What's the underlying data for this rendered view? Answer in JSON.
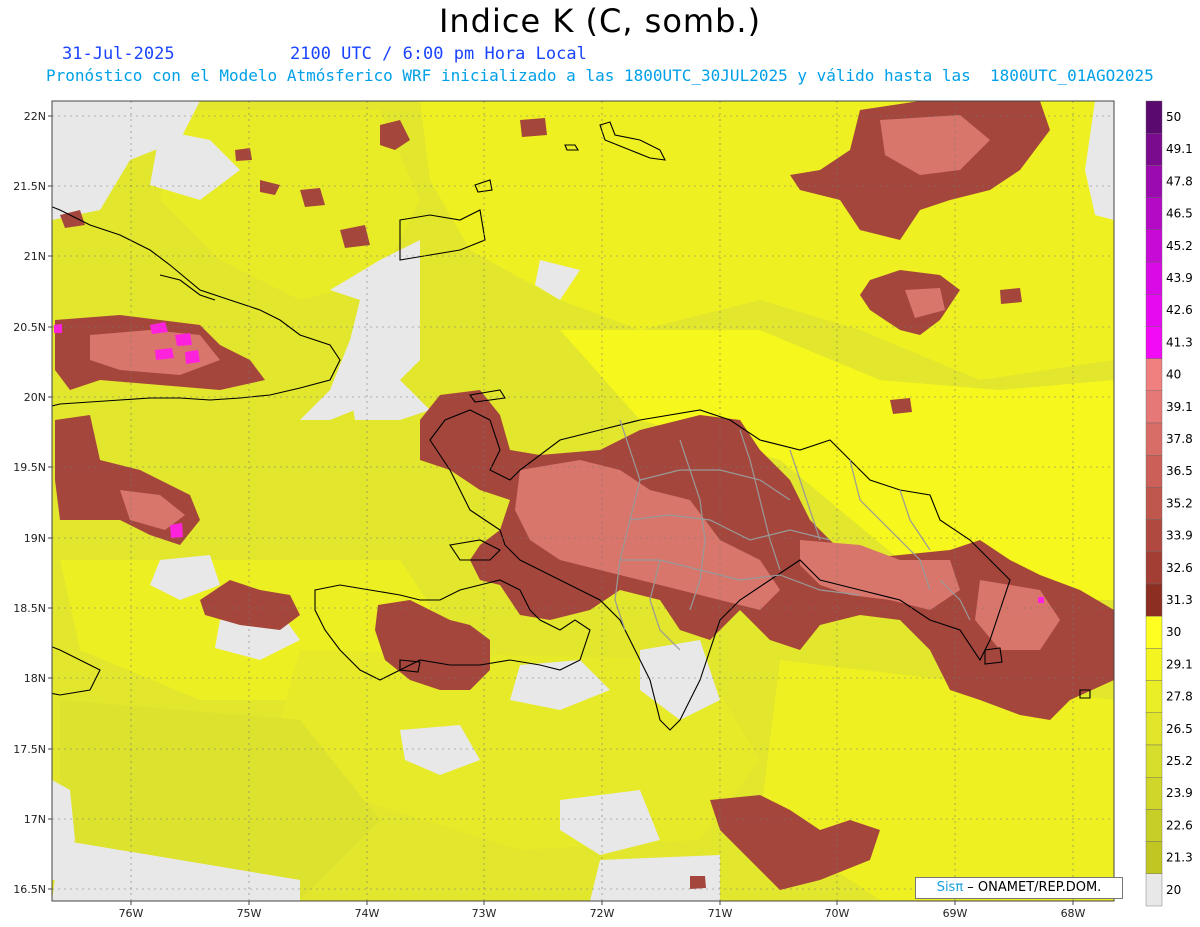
{
  "title": "Indice K (C, somb.)",
  "subtitle": {
    "date": "31-Jul-2025",
    "time": "2100 UTC / 6:00 pm Hora Local",
    "model_line": "Pronóstico con el Modelo Atmósferico WRF inicializado a las 1800UTC_30JUL2025 y válido hasta las  1800UTC_01AGO2025"
  },
  "axes": {
    "lat_labels": [
      "22N",
      "21.5N",
      "21N",
      "20.5N",
      "20N",
      "19.5N",
      "19N",
      "18.5N",
      "18N",
      "17.5N",
      "17N",
      "16.5N"
    ],
    "lon_labels": [
      "76W",
      "75W",
      "74W",
      "73W",
      "72W",
      "71W",
      "70W",
      "69W",
      "68W"
    ]
  },
  "colorbar": {
    "labels": [
      "50",
      "49.1",
      "47.8",
      "46.5",
      "45.2",
      "43.9",
      "42.6",
      "41.3",
      "40",
      "39.1",
      "37.8",
      "36.5",
      "35.2",
      "33.9",
      "32.6",
      "31.3",
      "30",
      "29.1",
      "27.8",
      "26.5",
      "25.2",
      "23.9",
      "22.6",
      "21.3",
      "20"
    ],
    "colors": [
      "#5a0a6e",
      "#7a0a8e",
      "#9a0aae",
      "#b40ac6",
      "#c80ad6",
      "#d80ae6",
      "#e60af0",
      "#f20af6",
      "#f08080",
      "#e67878",
      "#d86c66",
      "#cc6058",
      "#c0574d",
      "#b04a40",
      "#a23e34",
      "#8c2e22",
      "#ffff22",
      "#f4f420",
      "#eaee26",
      "#e2e62a",
      "#d8de2c",
      "#d0d62a",
      "#c8ce28",
      "#c2c622",
      "#e8e8e8"
    ]
  },
  "palette": {
    "land_low": "#e6ea28",
    "sea_mid": "#f3f51c",
    "high_k": "#a4463c",
    "high_k_core": "#d8766c",
    "extreme": "#ff22dd",
    "no_data": "#e8e8e8"
  },
  "credit": {
    "brand": "Sisπ",
    "text": " – ONAMET/REP.DOM."
  }
}
